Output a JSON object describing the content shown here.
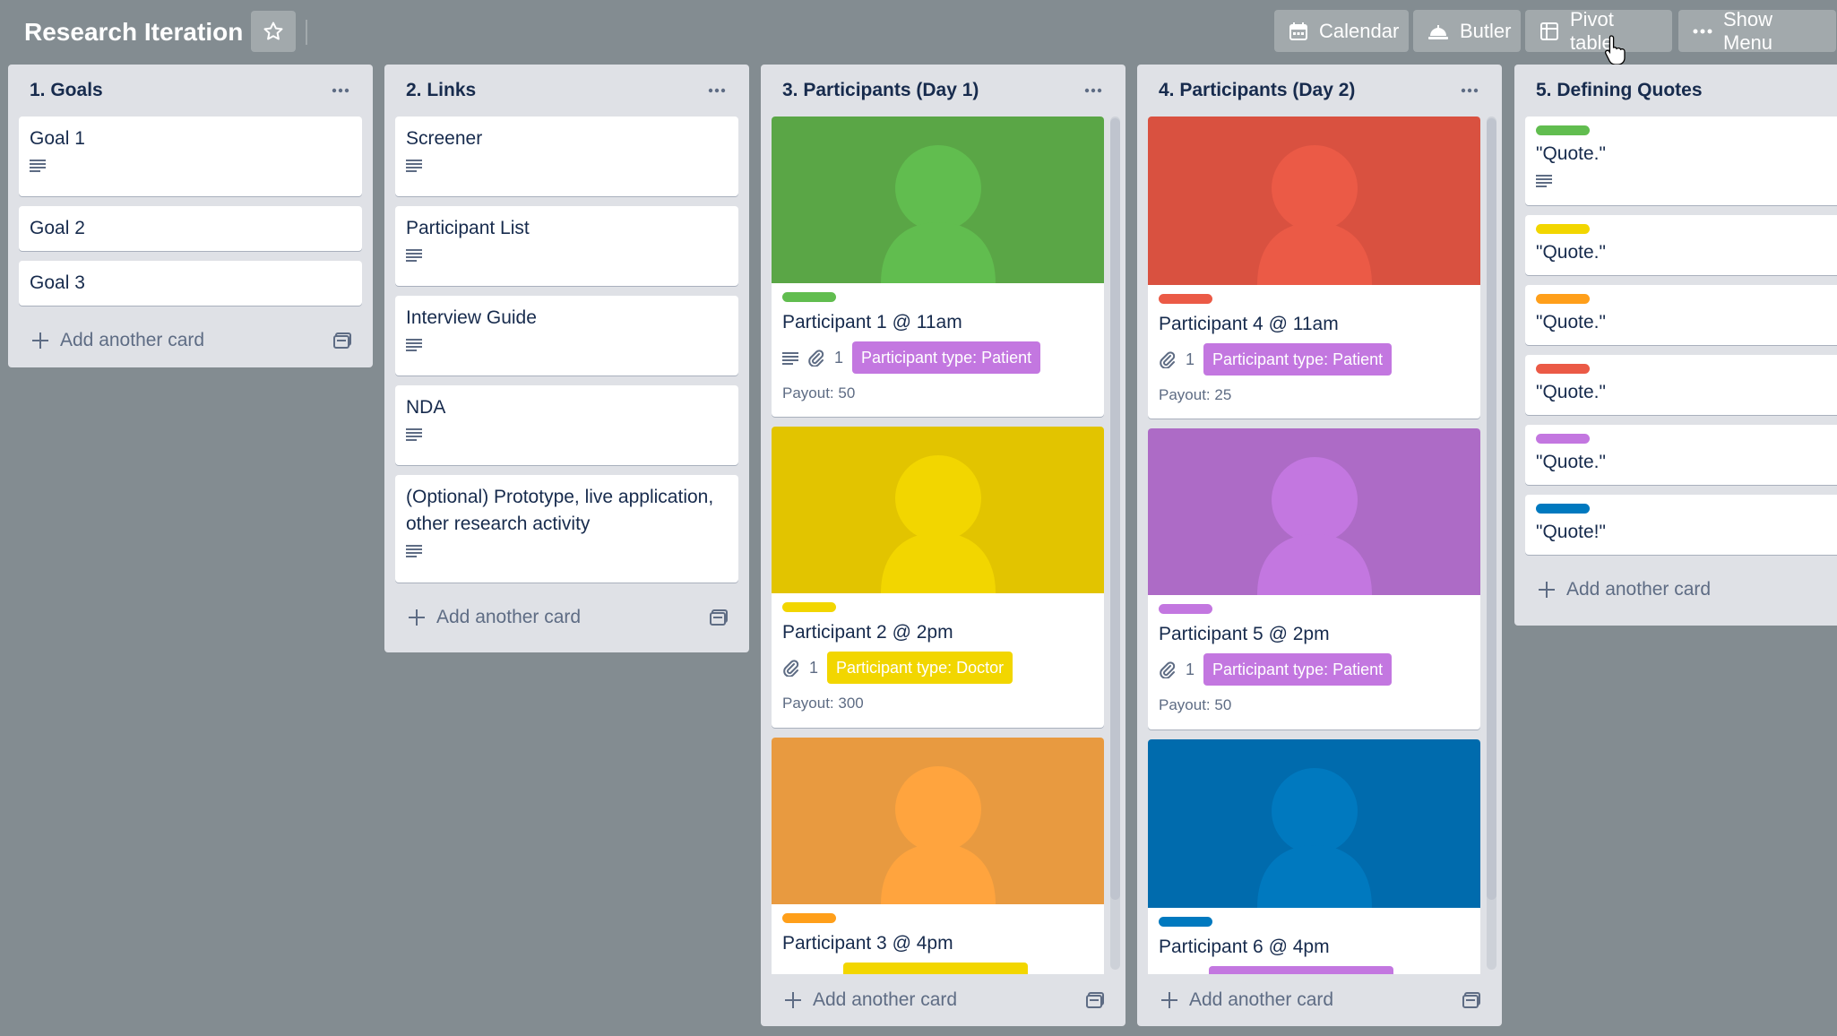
{
  "board": {
    "title": "Research Iteration",
    "buttons": {
      "calendar": "Calendar",
      "butler": "Butler",
      "pivot": "Pivot table",
      "menu": "Show Menu"
    }
  },
  "colors": {
    "background": "#838c91",
    "green": "#61bd4f",
    "yellow": "#f2d600",
    "orange": "#ff9f1a",
    "red": "#eb5a46",
    "purple": "#c377e0",
    "blue": "#0079bf"
  },
  "lists": {
    "goals": {
      "title": "1. Goals",
      "cards": [
        "Goal 1",
        "Goal 2",
        "Goal 3"
      ],
      "add": "Add another card"
    },
    "links": {
      "title": "2. Links",
      "cards": [
        "Screener",
        "Participant List",
        "Interview Guide",
        "NDA",
        "(Optional) Prototype, live application, other research activity"
      ],
      "add": "Add another card"
    },
    "day1": {
      "title": "3. Participants (Day 1)",
      "cards": [
        {
          "title": "Participant 1 @ 11am",
          "attachments": "1",
          "chip": "Participant type: Patient",
          "payout": "Payout: 50"
        },
        {
          "title": "Participant 2 @ 2pm",
          "attachments": "1",
          "chip": "Participant type: Doctor",
          "payout": "Payout: 300"
        },
        {
          "title": "Participant 3 @ 4pm"
        }
      ],
      "add": "Add another card"
    },
    "day2": {
      "title": "4. Participants (Day 2)",
      "cards": [
        {
          "title": "Participant 4 @ 11am",
          "attachments": "1",
          "chip": "Participant type: Patient",
          "payout": "Payout: 25"
        },
        {
          "title": "Participant 5 @ 2pm",
          "attachments": "1",
          "chip": "Participant type: Patient",
          "payout": "Payout: 50"
        },
        {
          "title": "Participant 6 @ 4pm"
        }
      ],
      "add": "Add another card"
    },
    "quotes": {
      "title": "5. Defining Quotes",
      "cards": [
        "\"Quote.\"",
        "\"Quote.\"",
        "\"Quote.\"",
        "\"Quote.\"",
        "\"Quote.\"",
        "\"Quote!\""
      ],
      "add": "Add another card"
    }
  }
}
